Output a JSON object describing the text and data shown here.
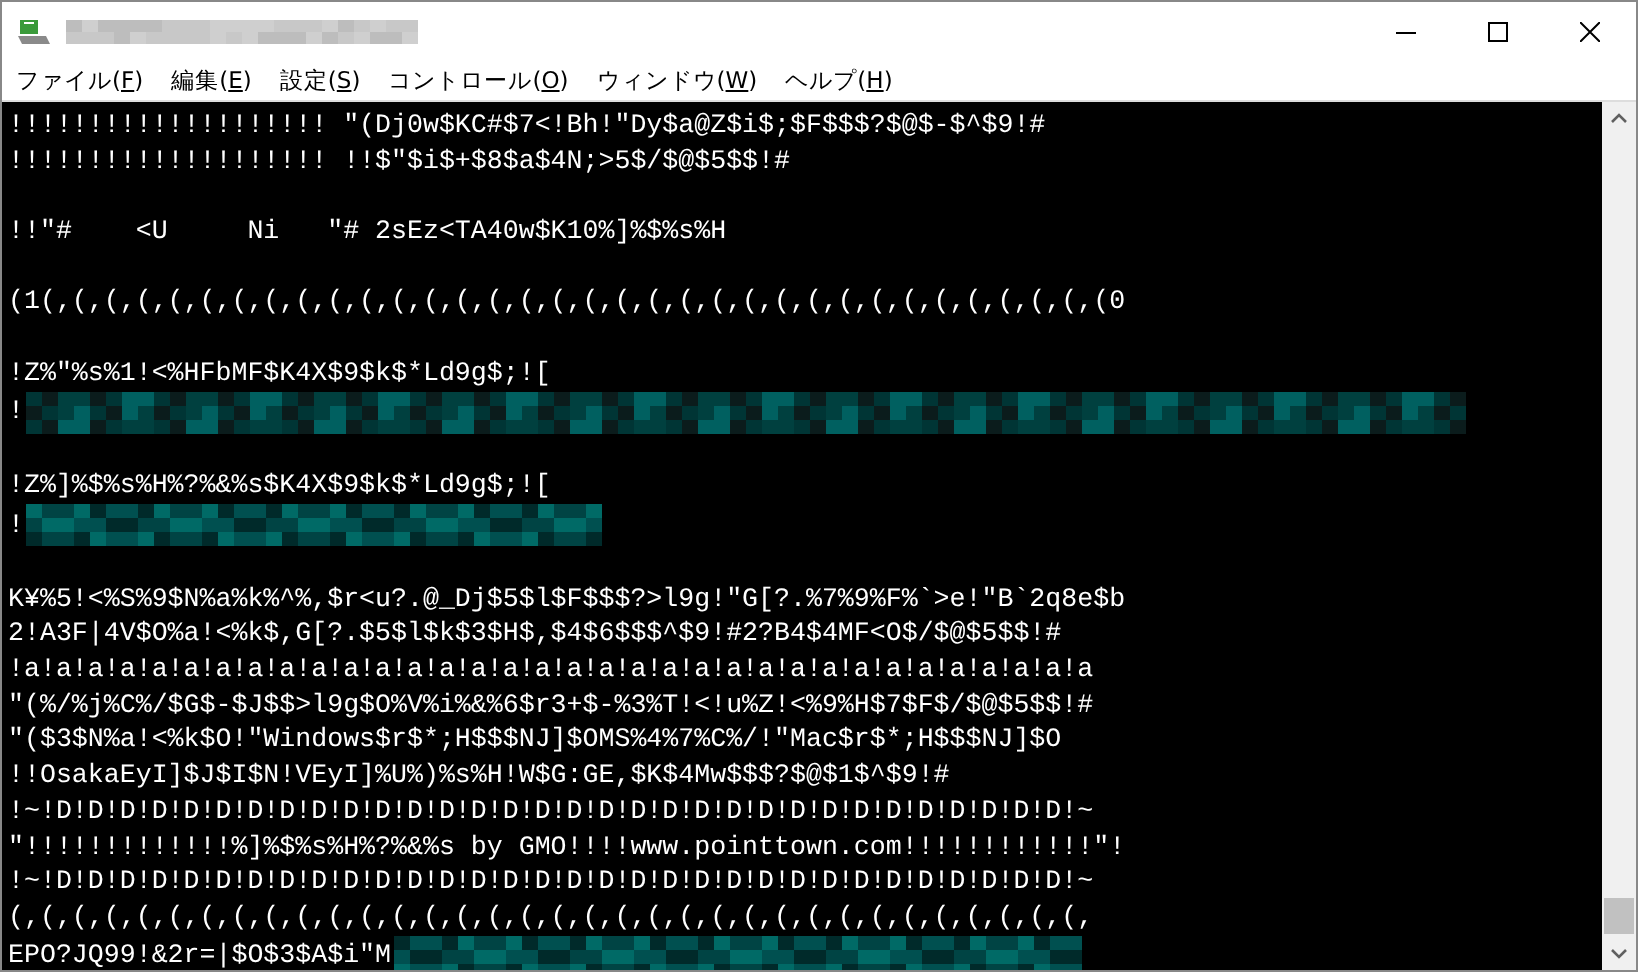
{
  "window": {
    "title_blurred": true
  },
  "menu": [
    {
      "label": "ファイル(F)"
    },
    {
      "label": "編集(E)"
    },
    {
      "label": "設定(S)"
    },
    {
      "label": "コントロール(O)"
    },
    {
      "label": "ウィンドウ(W)"
    },
    {
      "label": "ヘルプ(H)"
    }
  ],
  "terminal": {
    "lines": [
      {
        "kind": "text",
        "text": "!!!!!!!!!!!!!!!!!!!! \"(Dj0w$KC#$7<!Bh!\"Dy$a@Z$i$;$F$$$?$@$-$^$9!#"
      },
      {
        "kind": "text",
        "text": "!!!!!!!!!!!!!!!!!!!! !!$\"$i$+$8$a$4N;>5$/$@$5$$!#"
      },
      {
        "kind": "blank"
      },
      {
        "kind": "text",
        "text": "!!\"#    <U     Ni   \"# 2sEz<TA40w$K10%]%$%s%H"
      },
      {
        "kind": "blank"
      },
      {
        "kind": "text",
        "text": "(1(,(,(,(,(,(,(,(,(,(,(,(,(,(,(,(,(,(,(,(,(,(,(,(,(,(,(,(,(,(,(,(,(,(0"
      },
      {
        "kind": "blank"
      },
      {
        "kind": "text",
        "text": "!Z%\"%s%1!<%HFbMF$K4X$9$k$*Ld9g$;!["
      },
      {
        "kind": "longmask",
        "text": "!"
      },
      {
        "kind": "blank"
      },
      {
        "kind": "text",
        "text": "!Z%]%$%s%H%?%&%s$K4X$9$k$*Ld9g$;!["
      },
      {
        "kind": "shortmask",
        "text": "!"
      },
      {
        "kind": "blank"
      },
      {
        "kind": "text",
        "text": "K¥%5!<%S%9$N%a%k%^%,$r<u?.@_Dj$5$l$F$$$?>l9g!\"G[?.%7%9%F%`>e!\"B`2q8e$b"
      },
      {
        "kind": "text",
        "text": "2!A3F|4V$O%a!<%k$,G[?.$5$l$k$3$H$,$4$6$$$^$9!#2?B4$4MF<O$/$@$5$$!#"
      },
      {
        "kind": "text",
        "text": "!a!a!a!a!a!a!a!a!a!a!a!a!a!a!a!a!a!a!a!a!a!a!a!a!a!a!a!a!a!a!a!a!a!a"
      },
      {
        "kind": "text",
        "text": "\"(%/%j%C%/$G$-$J$$>l9g$O%V%i%&%6$r3+$-%3%T!<!u%Z!<%9%H$7$F$/$@$5$$!#"
      },
      {
        "kind": "text",
        "text": "\"($3$N%a!<%k$O!\"Windows$r$*;H$$$NJ]$OMS%4%7%C%/!\"Mac$r$*;H$$$NJ]$O"
      },
      {
        "kind": "text",
        "text": "!!OsakaEyI]$J$I$N!VEyI]%U%)%s%H!W$G:GE,$K$4Mw$$$?$@$1$^$9!#"
      },
      {
        "kind": "text",
        "text": "!~!D!D!D!D!D!D!D!D!D!D!D!D!D!D!D!D!D!D!D!D!D!D!D!D!D!D!D!D!D!D!D!D!~"
      },
      {
        "kind": "text",
        "text": "\"!!!!!!!!!!!!!%]%$%s%H%?%&%s by GMO!!!!www.pointtown.com!!!!!!!!!!!!\"!"
      },
      {
        "kind": "text",
        "text": "!~!D!D!D!D!D!D!D!D!D!D!D!D!D!D!D!D!D!D!D!D!D!D!D!D!D!D!D!D!D!D!D!D!~"
      },
      {
        "kind": "text",
        "text": "(,(,(,(,(,(,(,(,(,(,(,(,(,(,(,(,(,(,(,(,(,(,(,(,(,(,(,(,(,(,(,(,(,(,"
      },
      {
        "kind": "midmask",
        "text": "EPO?JQ99!&2r=|$O$3$A$i\"M"
      }
    ]
  }
}
